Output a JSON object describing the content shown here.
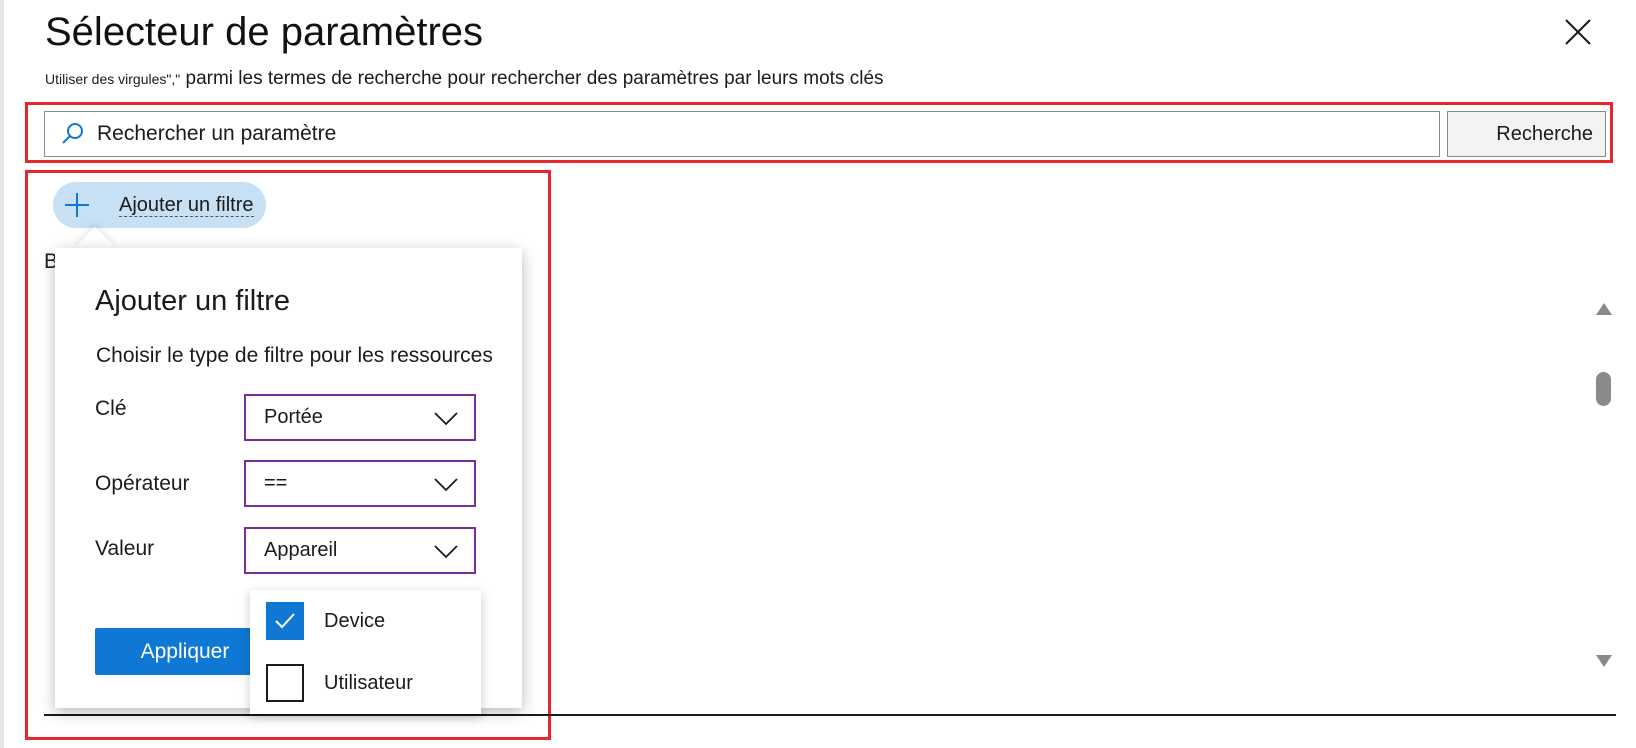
{
  "header": {
    "title": "Sélecteur de paramètres",
    "subtitle_prefix": "Utiliser des virgules",
    "subtitle_quote": "\",\"",
    "subtitle_rest": "parmi les termes de recherche pour rechercher des paramètres par leurs mots clés"
  },
  "search": {
    "placeholder": "Rechercher un paramètre",
    "button_label": "Recherche"
  },
  "filter_chip": {
    "label": "Ajouter un filtre"
  },
  "behind_text": "B",
  "popover": {
    "title": "Ajouter un filtre",
    "description": "Choisir le type de filtre pour les ressources",
    "fields": [
      {
        "label": "Clé",
        "value": "Portée"
      },
      {
        "label": "Opérateur",
        "value": "=="
      },
      {
        "label": "Valeur",
        "value": "Appareil"
      }
    ],
    "apply_label": "Appliquer"
  },
  "value_options": [
    {
      "label": "Device",
      "checked": true
    },
    {
      "label": "Utilisateur",
      "checked": false
    }
  ],
  "colors": {
    "accent": "#0f78d4",
    "highlight": "#e8262d",
    "dropdown_border": "#7a2d9e",
    "chip_bg": "#c7e0f4"
  },
  "icons": [
    "close-icon",
    "search-icon",
    "plus-icon",
    "chevron-down-icon",
    "checkmark-icon",
    "scroll-up-icon",
    "scroll-down-icon"
  ]
}
